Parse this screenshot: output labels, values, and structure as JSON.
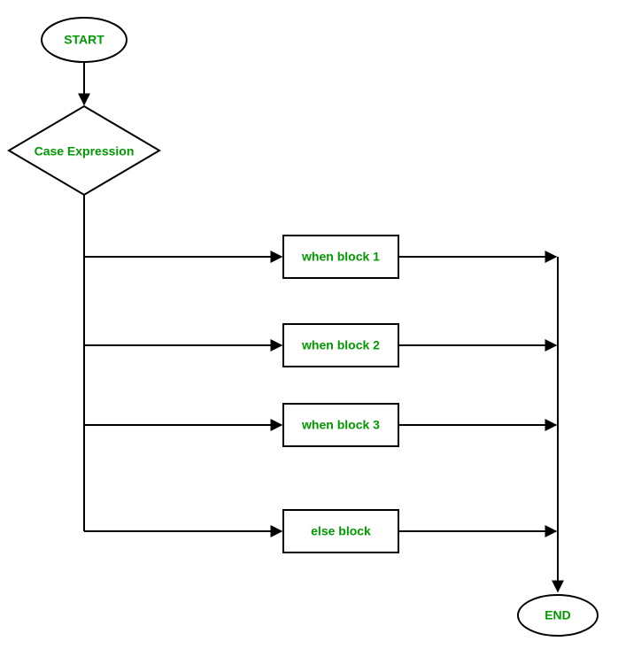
{
  "flow": {
    "start": "START",
    "decision": "Case Expression",
    "blocks": {
      "b1": "when block 1",
      "b2": "when block 2",
      "b3": "when block 3",
      "b4": "else block"
    },
    "end": "END"
  },
  "colors": {
    "text": "#009900",
    "stroke": "#000000",
    "bg": "#ffffff"
  }
}
